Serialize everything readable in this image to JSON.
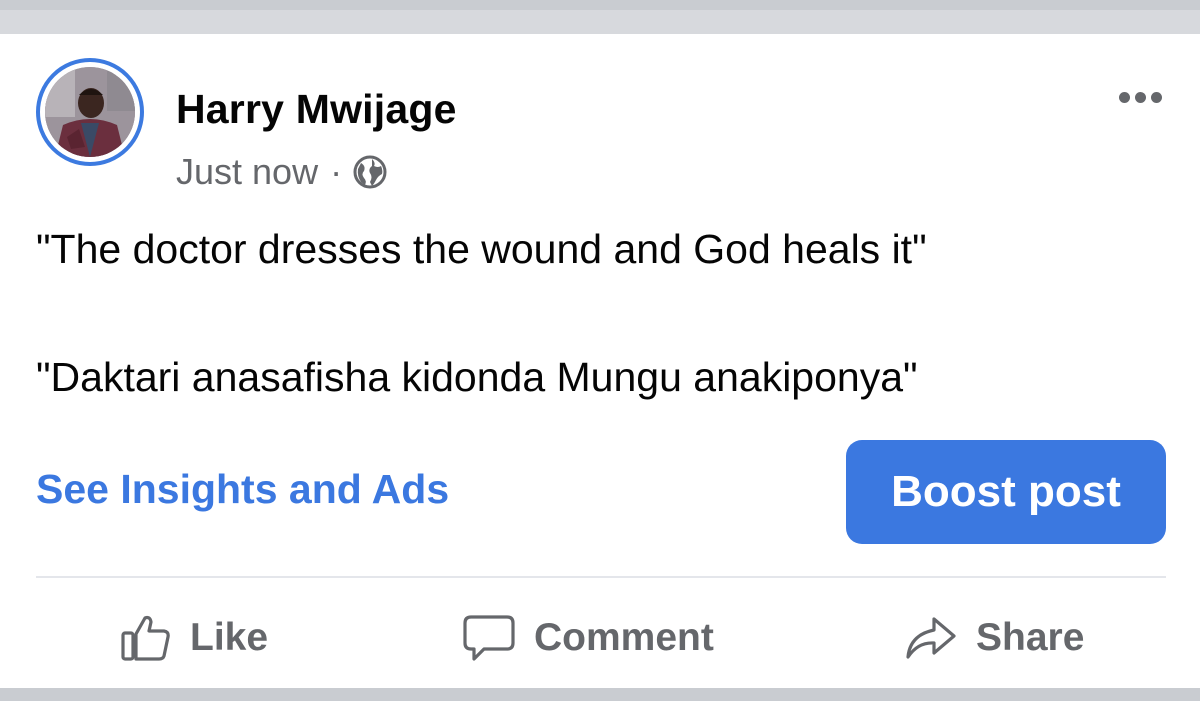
{
  "post": {
    "author": "Harry Mwijage",
    "timestamp": "Just now",
    "separator": "·",
    "privacy_icon": "globe-icon",
    "more_icon": "more-options-icon",
    "text_lines": [
      "\"The doctor dresses the wound and God heals it\"",
      "\"Daktari anasafisha kidonda Mungu anakiponya\""
    ]
  },
  "cta": {
    "insights_link": "See Insights and Ads",
    "boost_button": "Boost post"
  },
  "actions": [
    {
      "label": "Like",
      "icon": "thumbs-up-icon"
    },
    {
      "label": "Comment",
      "icon": "comment-bubble-icon"
    },
    {
      "label": "Share",
      "icon": "share-arrow-icon"
    }
  ],
  "colors": {
    "accent": "#3b78e0",
    "avatar_ring": "#3c7ae0",
    "text_primary": "#050505",
    "text_secondary": "#65676b",
    "divider": "#e4e6eb",
    "background_gap": "#c9ccd1"
  }
}
